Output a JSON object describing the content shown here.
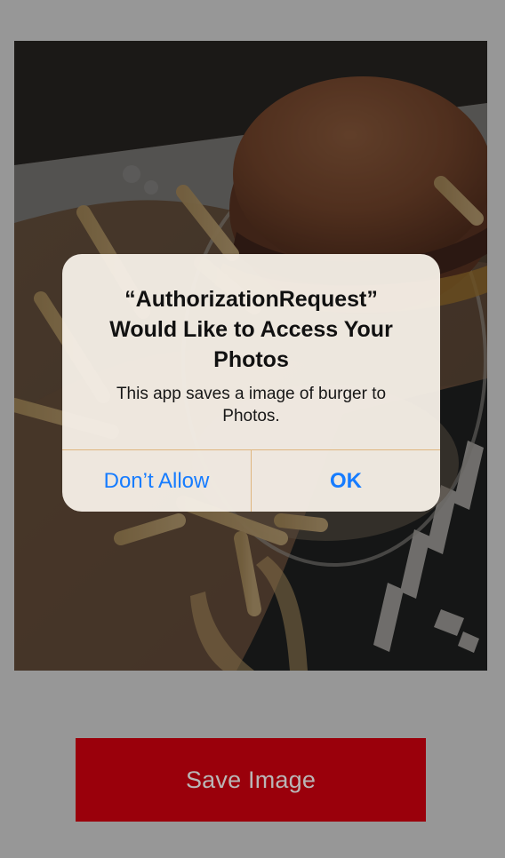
{
  "alert": {
    "title": "“AuthorizationRequest” Would Like to Access Your Photos",
    "message": "This app saves a image of burger to Photos.",
    "dont_allow_label": "Don’t Allow",
    "ok_label": "OK"
  },
  "save_button": {
    "label": "Save Image"
  },
  "colors": {
    "background": "#979797",
    "save_button": "#9a000b",
    "alert_action": "#167cff"
  }
}
